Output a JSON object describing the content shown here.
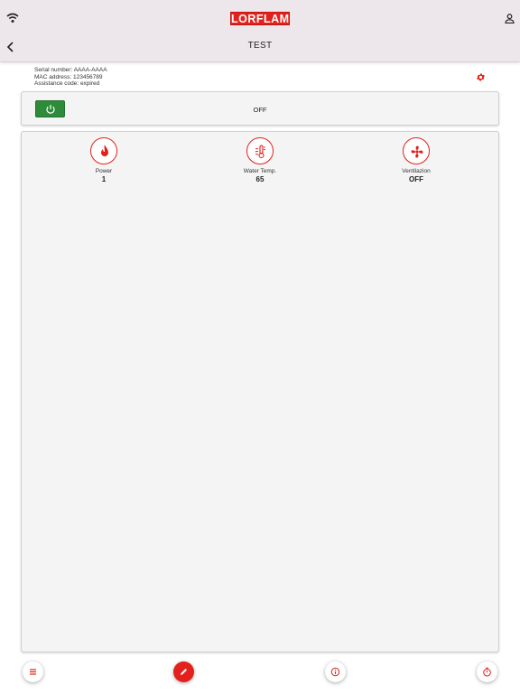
{
  "header": {
    "brand": "LORFLAM",
    "title": "TEST"
  },
  "device": {
    "serial": "Serial number: AAAA-AAAA",
    "mac": "MAC address: 123456789",
    "assistance": "Assistance code: expired"
  },
  "power": {
    "status": "OFF"
  },
  "stats": [
    {
      "label": "Power",
      "value": "1",
      "icon": "flame-icon"
    },
    {
      "label": "Water Temp.",
      "value": "65",
      "icon": "water-temperature-icon"
    },
    {
      "label": "Ventilazion",
      "value": "OFF",
      "icon": "fan-icon"
    }
  ],
  "bottom_nav": [
    "menu-icon",
    "edit-icon",
    "info-icon",
    "timer-icon"
  ],
  "colors": {
    "brand_red": "#e3201b",
    "power_green": "#2e8b3a",
    "topbar": "#ede7ec",
    "card": "#f4f4f4"
  }
}
